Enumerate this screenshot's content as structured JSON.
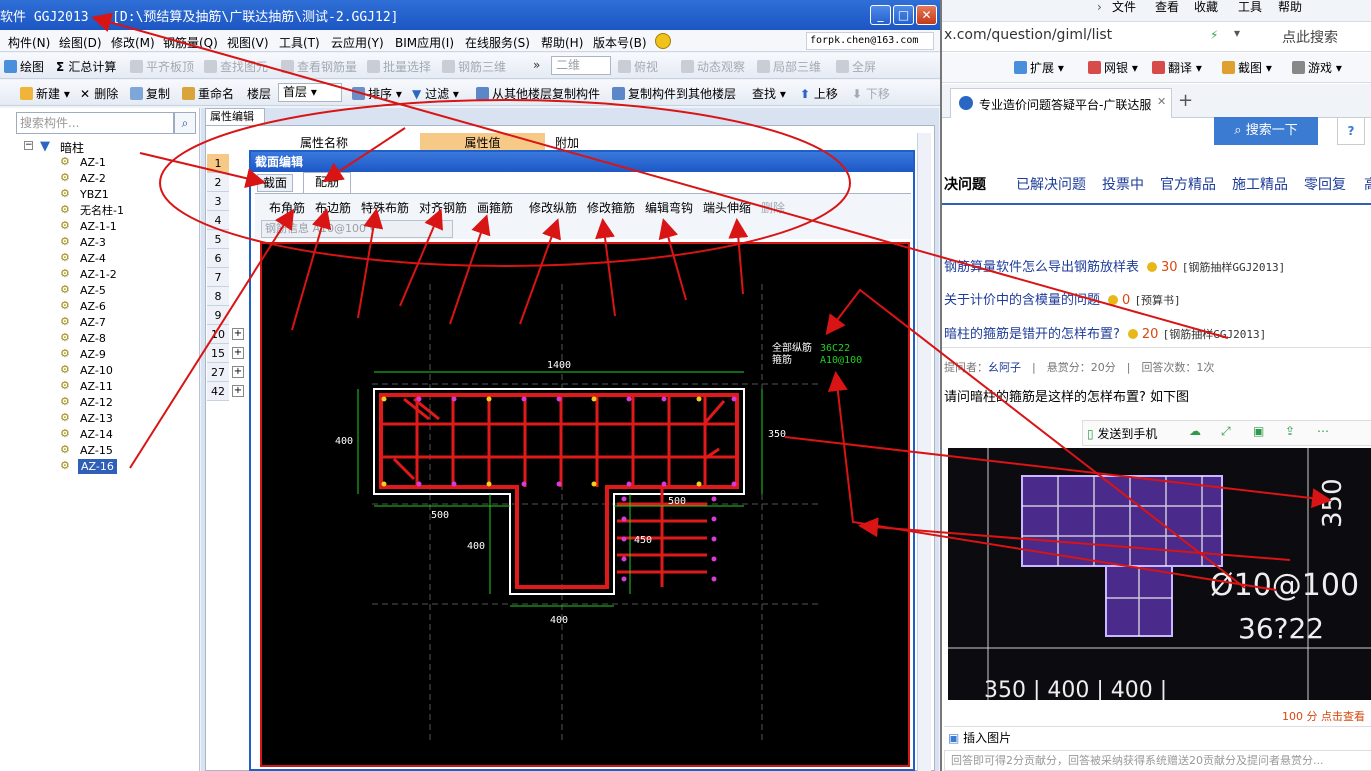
{
  "app": {
    "title": "软件 GGJ2013 - [D:\\预结算及抽筋\\广联达抽筋\\测试-2.GGJ12]",
    "menu": [
      "构件(N)",
      "绘图(D)",
      "修改(M)",
      "钢筋量(Q)",
      "视图(V)",
      "工具(T)",
      "云应用(Y)",
      "BIM应用(I)",
      "在线服务(S)",
      "帮助(H)",
      "版本号(B)"
    ],
    "account": "forpk.chen@163.com",
    "toolbar1": [
      "绘图",
      "汇总计算",
      "平齐板顶",
      "查找图元",
      "查看钢筋量",
      "批量选择",
      "钢筋三维",
      "二维",
      "俯视",
      "动态观察",
      "局部三维",
      "全屏"
    ],
    "toolbar2": [
      "新建",
      "删除",
      "复制",
      "重命名",
      "楼层",
      "首层",
      "排序",
      "过滤",
      "从其他楼层复制构件",
      "复制构件到其他楼层",
      "查找",
      "上移",
      "下移"
    ],
    "search_placeholder": "搜索构件...",
    "tree_root": "暗柱",
    "tree_items": [
      "AZ-1",
      "AZ-2",
      "YBZ1",
      "无名柱-1",
      "AZ-1-1",
      "AZ-3",
      "AZ-4",
      "AZ-1-2",
      "AZ-5",
      "AZ-6",
      "AZ-7",
      "AZ-8",
      "AZ-9",
      "AZ-10",
      "AZ-11",
      "AZ-12",
      "AZ-13",
      "AZ-14",
      "AZ-15",
      "AZ-16"
    ],
    "prop_tab": "属性编辑",
    "prop_headers": [
      "属性名称",
      "属性值",
      "附加"
    ],
    "row_numbers": [
      "1",
      "2",
      "3",
      "4",
      "5",
      "6",
      "7",
      "8",
      "9",
      "10",
      "15",
      "27",
      "42"
    ]
  },
  "dialog": {
    "title": "截面编辑",
    "tabs": [
      "截面",
      "配筋"
    ],
    "tools": [
      "布角筋",
      "布边筋",
      "特殊布筋",
      "对齐钢筋",
      "画箍筋",
      "修改纵筋",
      "修改箍筋",
      "编辑弯钩",
      "端头伸缩",
      "删除"
    ],
    "rebar_info_label": "钢筋信息",
    "rebar_info_value": "A10@100",
    "legend_labels": [
      "全部纵筋",
      "箍筋"
    ],
    "legend_values": [
      "36C22",
      "A10@100"
    ],
    "dims": {
      "top": "1400",
      "left": "400",
      "right": "350",
      "bottom_left": "500",
      "bottom_right": "500",
      "web_left": "400",
      "web_right": "450",
      "web_bottom": "400"
    }
  },
  "browser": {
    "nav": [
      "文件",
      "查看",
      "收藏",
      "工具",
      "帮助"
    ],
    "url": "x.com/question/giml/list",
    "search_hint": "点此搜索",
    "favorites": [
      "扩展",
      "网银",
      "翻译",
      "截图",
      "游戏"
    ],
    "tab_title": "专业造价问题答疑平台-广联达服",
    "search_button": "搜索一下",
    "question_tabs": [
      "决问题",
      "已解决问题",
      "投票中",
      "官方精品",
      "施工精品",
      "零回复",
      "高"
    ],
    "questions": [
      {
        "title": "钢筋算量软件怎么导出钢筋放样表",
        "points": "30",
        "tag": "[钢筋抽样GGJ2013]"
      },
      {
        "title": "关于计价中的含模量的问题",
        "points": "0",
        "tag": "[预算书]"
      },
      {
        "title": "暗柱的箍筋是错开的怎样布置?",
        "points": "20",
        "tag": "[钢筋抽样GGJ2013]"
      }
    ],
    "meta": {
      "asker_label": "提问者：",
      "asker": "幺阿子",
      "reward": "悬赏分：20分",
      "answers": "回答次数：1次"
    },
    "body": "请问暗柱的箍筋是这样的怎样布置? 如下图",
    "send_phone": "发送到手机",
    "photo_labels": [
      "350",
      "Ø10@100",
      "36?22",
      "350 | 400 | 400 |"
    ],
    "side_points": "100 分 点击查看",
    "insert_image": "插入图片",
    "footer": "回答即可得2分贡献分，回答被采纳获得系统赠送20贡献分及提问者悬赏分..."
  },
  "colors": {
    "titlebar": "#1c56c4",
    "canvas": "#000000",
    "rebar": "#e01a1a",
    "dims": "#22d022",
    "annotation": "#d81414"
  }
}
